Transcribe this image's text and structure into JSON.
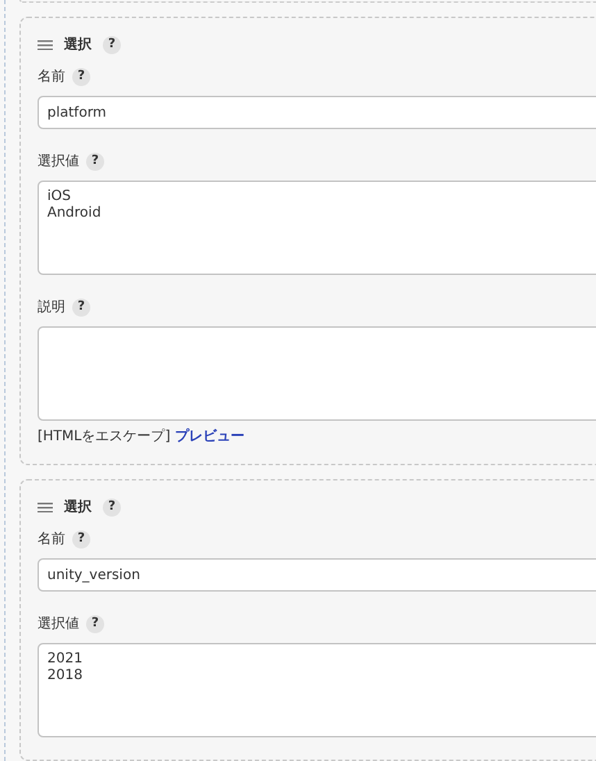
{
  "panels": [
    {
      "title": "選択",
      "help": "?",
      "fields": [
        {
          "kind": "input",
          "label": "名前",
          "help": "?",
          "value": "platform"
        },
        {
          "kind": "textarea",
          "label": "選択値",
          "help": "?",
          "value": "iOS\nAndroid"
        },
        {
          "kind": "textarea",
          "label": "説明",
          "help": "?"
        }
      ],
      "footer": {
        "note": "[HTMLをエスケープ]",
        "link": "プレビュー"
      }
    },
    {
      "title": "選択",
      "help": "?",
      "fields": [
        {
          "kind": "input",
          "label": "名前",
          "help": "?",
          "value": "unity_version"
        },
        {
          "kind": "textarea",
          "label": "選択値",
          "help": "?",
          "value": "2021\n2018"
        }
      ]
    }
  ]
}
